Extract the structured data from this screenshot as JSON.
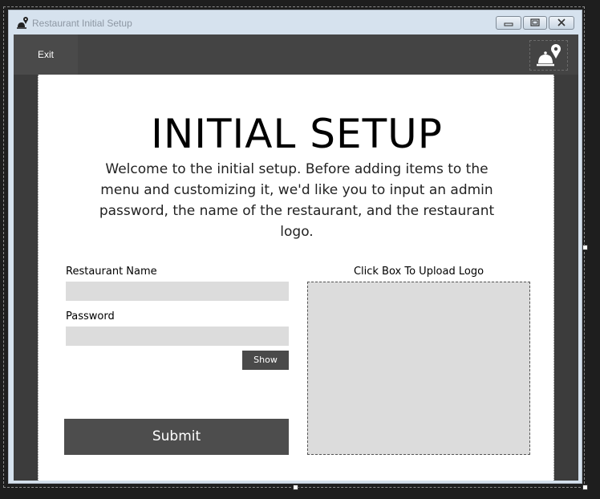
{
  "window": {
    "title": "Restaurant Initial Setup",
    "title_icon": "restaurant-bell-pin-icon"
  },
  "toolbar": {
    "exit_label": "Exit",
    "logo_icon": "restaurant-bell-pin-icon"
  },
  "setup": {
    "heading": "INITIAL SETUP",
    "intro": "Welcome to the initial setup. Before adding items to the menu and customizing it, we'd like you to input an admin password, the name of the restaurant, and the restaurant logo.",
    "restaurant_name_label": "Restaurant Name",
    "restaurant_name_value": "",
    "password_label": "Password",
    "password_value": "",
    "show_label": "Show",
    "submit_label": "Submit",
    "upload_label": "Click Box To Upload Logo"
  },
  "colors": {
    "client_bg": "#3c3c3c",
    "topbar_bg": "#444444",
    "button_bg": "#4d4d4d",
    "field_bg": "#dcdcdc"
  }
}
